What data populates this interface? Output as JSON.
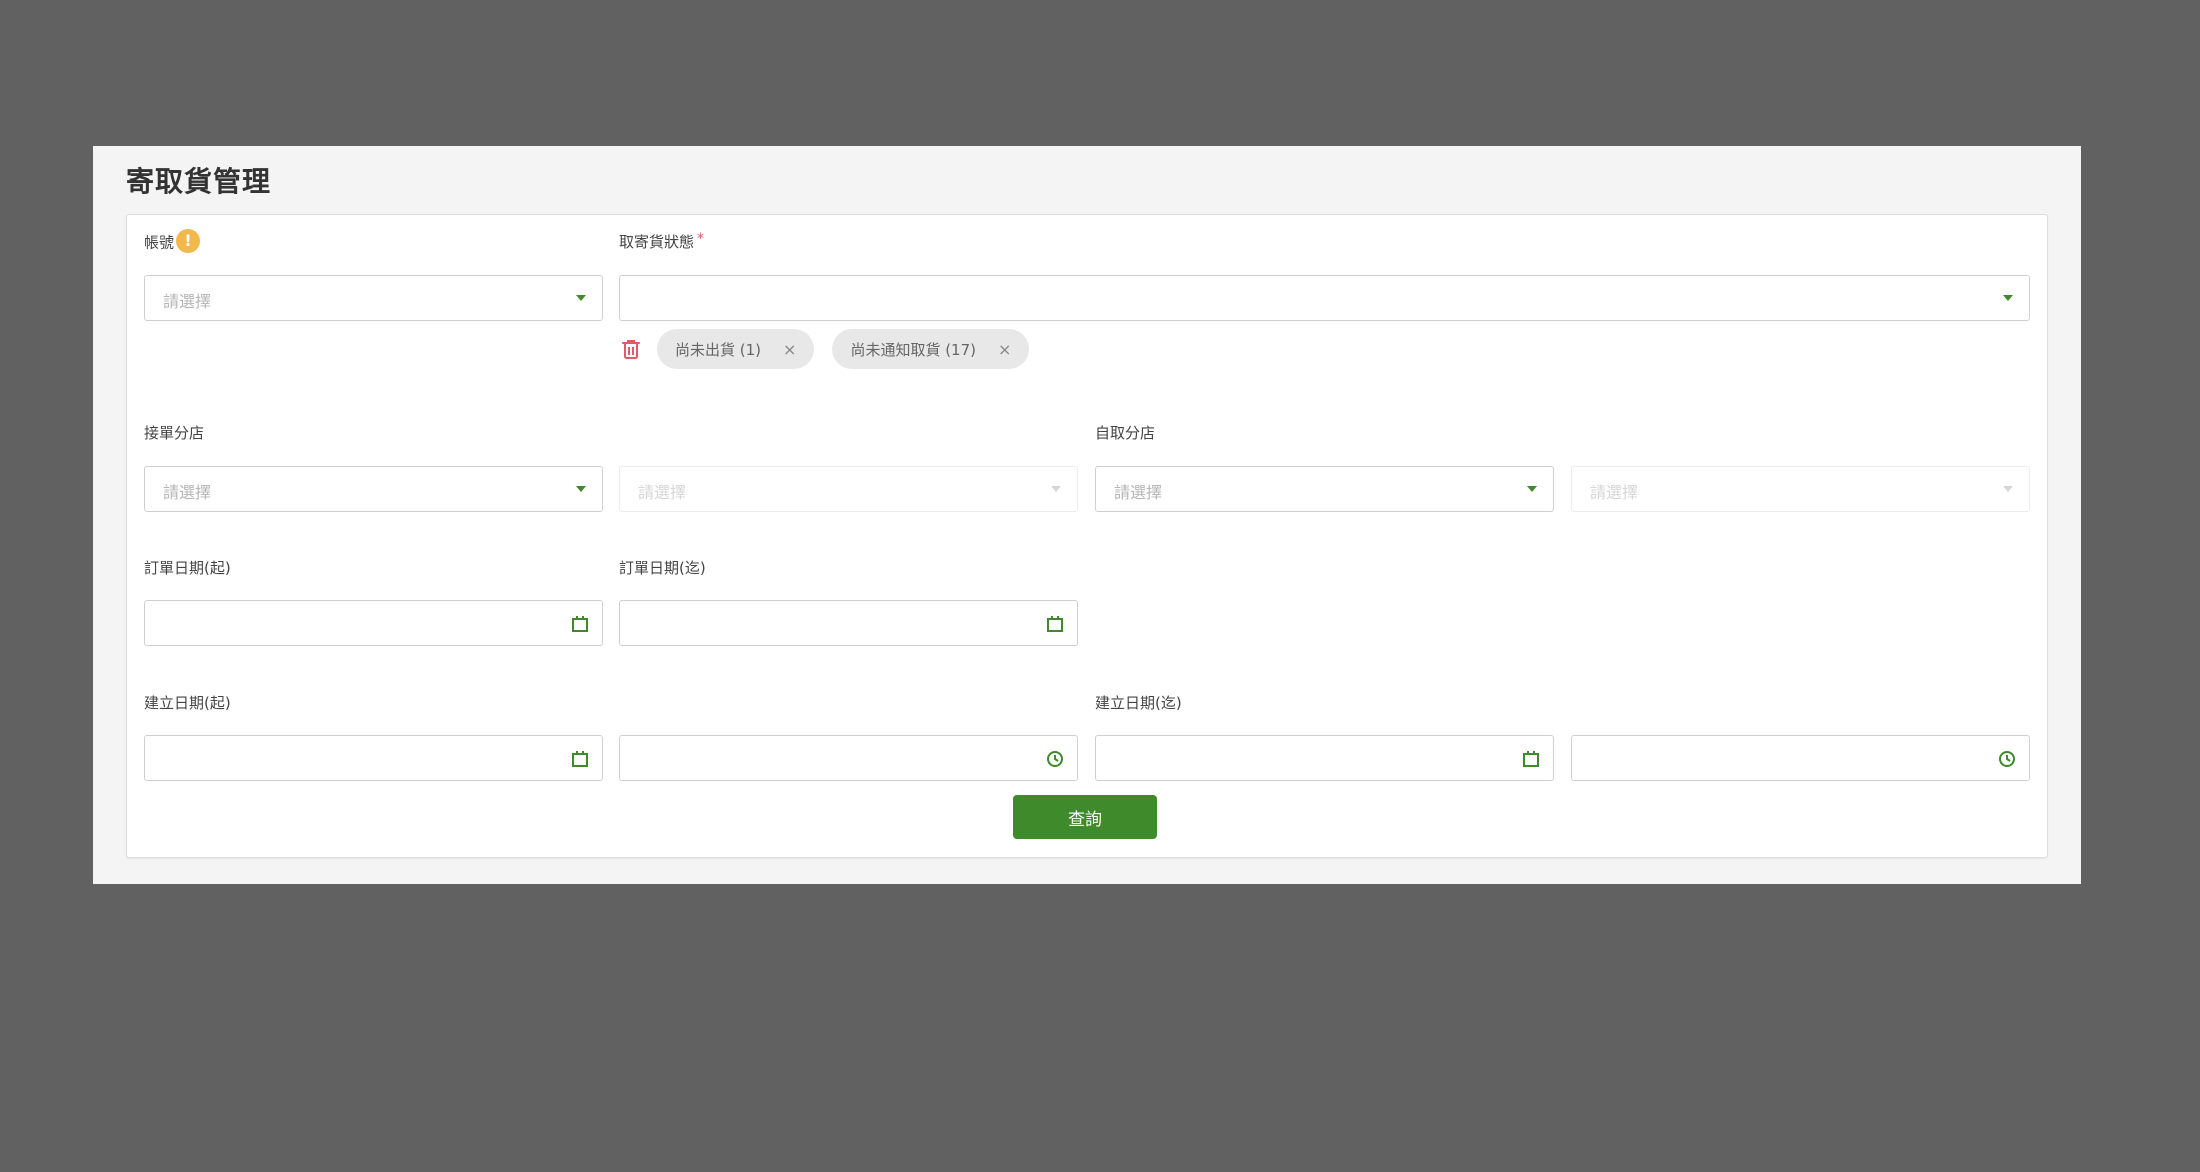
{
  "page": {
    "title": "寄取貨管理"
  },
  "form": {
    "account": {
      "label": "帳號",
      "info_icon": "info-icon",
      "placeholder": "請選擇"
    },
    "status": {
      "label": "取寄貨狀態",
      "required_mark": "*",
      "chips": [
        {
          "label": "尚未出貨 (1)",
          "remove": "×"
        },
        {
          "label": "尚未通知取貨 (17)",
          "remove": "×"
        }
      ]
    },
    "receiving_branch": {
      "label": "接單分店",
      "placeholder": "請選擇",
      "sub_placeholder": "請選擇"
    },
    "pickup_branch": {
      "label": "自取分店",
      "placeholder": "請選擇",
      "sub_placeholder": "請選擇"
    },
    "order_date_start": {
      "label": "訂單日期(起)"
    },
    "order_date_end": {
      "label": "訂單日期(迄)"
    },
    "created_date_start": {
      "label": "建立日期(起)"
    },
    "created_date_end": {
      "label": "建立日期(迄)"
    },
    "query_button": "查詢"
  },
  "colors": {
    "accent": "#3f8a2a",
    "danger": "#e05a6a",
    "info": "#f2b84b",
    "backdrop": "#616161"
  }
}
